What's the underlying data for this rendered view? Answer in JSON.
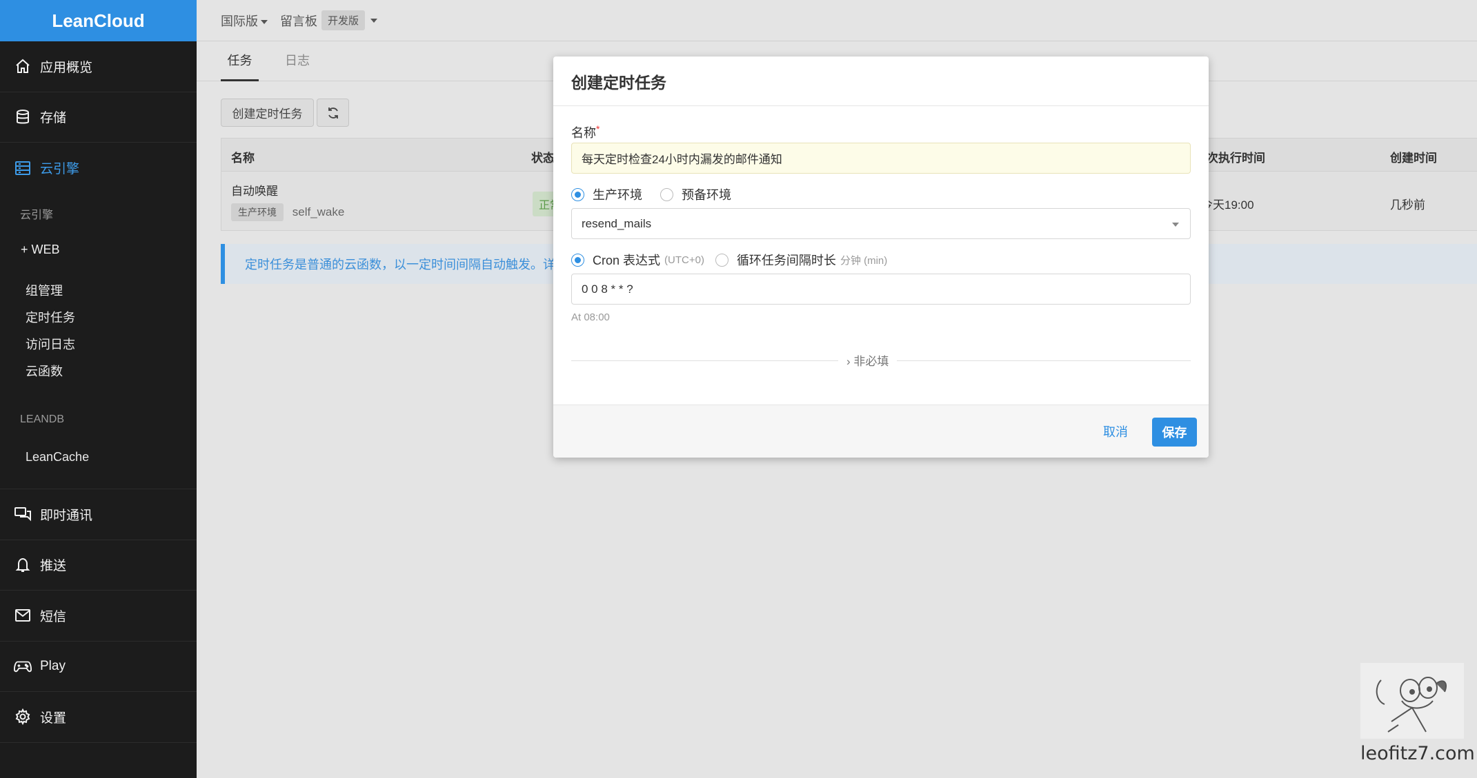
{
  "brand": "LeanCloud",
  "sidebar": {
    "items": [
      {
        "label": "应用概览",
        "icon": "home-icon"
      },
      {
        "label": "存储",
        "icon": "database-icon"
      },
      {
        "label": "云引擎",
        "icon": "server-icon"
      },
      {
        "label": "即时通讯",
        "icon": "chat-icon"
      },
      {
        "label": "推送",
        "icon": "bell-icon"
      },
      {
        "label": "短信",
        "icon": "mail-icon"
      },
      {
        "label": "Play",
        "icon": "gamepad-icon"
      },
      {
        "label": "设置",
        "icon": "gear-icon"
      }
    ],
    "engine_sub": {
      "heading": "云引擎",
      "web": "+ WEB",
      "items": [
        "组管理",
        "定时任务",
        "访问日志",
        "云函数"
      ],
      "leandb_heading": "LEANDB",
      "leancache": "LeanCache"
    }
  },
  "topbar": {
    "region": "国际版",
    "app": "留言板",
    "plan": "开发版"
  },
  "tabs": [
    "任务",
    "日志"
  ],
  "toolbar": {
    "create_label": "创建定时任务",
    "refresh_icon": "refresh-icon"
  },
  "table": {
    "headers": {
      "name": "名称",
      "status": "状态",
      "next_run": "下次执行时间",
      "created": "创建时间"
    },
    "rows": [
      {
        "name": "自动唤醒",
        "env": "生产环境",
        "function": "self_wake",
        "status": "正常",
        "next_run": "今天19:00",
        "created": "几秒前"
      }
    ]
  },
  "info_text": "定时任务是普通的云函数，以一定时间间隔自动触发。详情",
  "modal": {
    "title": "创建定时任务",
    "name_label": "名称",
    "required_mark": "*",
    "name_value": "每天定时检查24小时内漏发的邮件通知",
    "env_options": [
      "生产环境",
      "预备环境"
    ],
    "env_selected": 0,
    "function_value": "resend_mails",
    "schedule_options": [
      {
        "label": "Cron 表达式",
        "note": "(UTC+0)"
      },
      {
        "label": "循环任务间隔时长",
        "note": "分钟 (min)"
      }
    ],
    "schedule_selected": 0,
    "cron_value": "0 0 8 * * ?",
    "cron_hint": "At 08:00",
    "optional_label": "非必填",
    "cancel_label": "取消",
    "save_label": "保存"
  },
  "watermark": "leofitz7.com",
  "colors": {
    "accent": "#2e8fe2",
    "sidebar_bg": "#1c1c1c",
    "success": "#5a9a48"
  }
}
